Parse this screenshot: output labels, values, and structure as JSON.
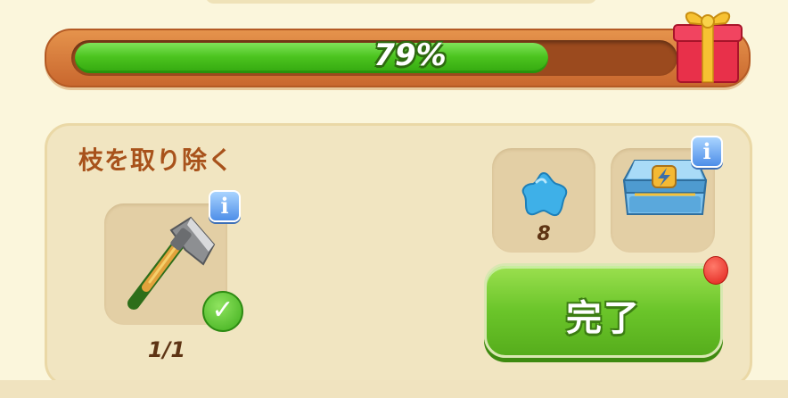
{
  "progress": {
    "percent": 79,
    "label": "79%"
  },
  "task": {
    "title": "枝を取り除く",
    "requirement": {
      "icon": "axe-icon",
      "count_label": "1/1",
      "completed": true
    }
  },
  "rewards": [
    {
      "icon": "blue-star-gem-icon",
      "count_label": "8"
    },
    {
      "icon": "energy-chest-icon"
    }
  ],
  "buttons": {
    "complete_label": "完了",
    "info_label": "i",
    "check_mark": "✓"
  },
  "colors": {
    "background": "#fbf6dc",
    "progress_fill": "#4cc41f",
    "progress_frame": "#d97a3a",
    "title": "#a8521b",
    "button_green": "#6bc52a",
    "info_blue": "#4e8ee8",
    "notification_red": "#e0201a"
  }
}
